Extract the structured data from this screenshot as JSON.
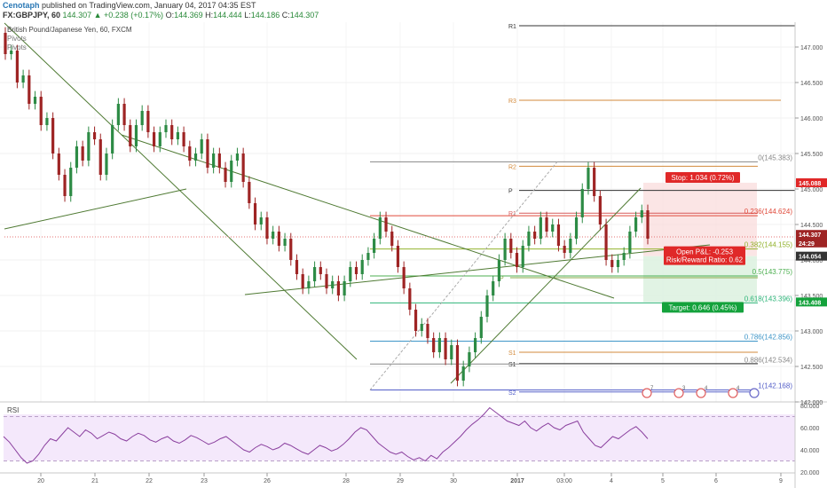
{
  "header": {
    "author": "Cenotaph",
    "published": "published on TradingView.com, January 04, 2017 04:35 EST",
    "symbol": "FX:GBPJPY, 60",
    "change": "144.307 ▲ +0.238 (+0.17%)",
    "ohlc": [
      {
        "k": "O:",
        "v": "144.369"
      },
      {
        "k": "H:",
        "v": "144.444"
      },
      {
        "k": "L:",
        "v": "144.186"
      },
      {
        "k": "C:",
        "v": "144.307"
      }
    ]
  },
  "legend": {
    "instrument": "British Pound/Japanese Yen, 60, FXCM",
    "items": [
      "Pivots",
      "Pivots"
    ]
  },
  "chart_data": [
    {
      "type": "candlestick",
      "title": "British Pound/Japanese Yen, 60, FXCM",
      "ylim": [
        142.0,
        147.35
      ],
      "y_ticks": [
        "147.000",
        "146.500",
        "146.000",
        "145.500",
        "145.000",
        "144.500",
        "144.000",
        "143.500",
        "143.000",
        "142.500",
        "142.000"
      ],
      "x_ticks": [
        "20",
        "21",
        "22",
        "23",
        "26",
        "28",
        "29",
        "30",
        "2017",
        "03:00",
        "4",
        "5",
        "6",
        "9"
      ],
      "candles": [
        [
          147.2,
          146.9
        ],
        [
          146.9,
          146.95
        ],
        [
          146.95,
          146.5
        ],
        [
          146.5,
          146.6
        ],
        [
          146.6,
          146.2
        ],
        [
          146.2,
          146.3
        ],
        [
          146.3,
          145.9
        ],
        [
          145.9,
          146.0
        ],
        [
          146.0,
          145.5
        ],
        [
          145.5,
          145.2
        ],
        [
          145.2,
          144.9
        ],
        [
          144.9,
          145.3
        ],
        [
          145.3,
          145.6
        ],
        [
          145.6,
          145.4
        ],
        [
          145.4,
          145.8
        ],
        [
          145.8,
          145.7
        ],
        [
          145.7,
          145.2
        ],
        [
          145.2,
          145.5
        ],
        [
          145.5,
          145.9
        ],
        [
          145.9,
          146.2
        ],
        [
          146.2,
          145.9
        ],
        [
          145.9,
          145.6
        ],
        [
          145.6,
          145.9
        ],
        [
          145.9,
          146.1
        ],
        [
          146.1,
          145.8
        ],
        [
          145.8,
          145.6
        ],
        [
          145.6,
          145.8
        ],
        [
          145.8,
          145.9
        ],
        [
          145.9,
          145.7
        ],
        [
          145.7,
          145.8
        ],
        [
          145.8,
          145.6
        ],
        [
          145.6,
          145.4
        ],
        [
          145.4,
          145.5
        ],
        [
          145.5,
          145.7
        ],
        [
          145.7,
          145.3
        ],
        [
          145.3,
          145.5
        ],
        [
          145.5,
          145.3
        ],
        [
          145.3,
          145.1
        ],
        [
          145.1,
          145.4
        ],
        [
          145.4,
          145.5
        ],
        [
          145.5,
          145.1
        ],
        [
          145.1,
          144.8
        ],
        [
          144.8,
          144.5
        ],
        [
          144.5,
          144.6
        ],
        [
          144.6,
          144.3
        ],
        [
          144.3,
          144.4
        ],
        [
          144.4,
          144.2
        ],
        [
          144.2,
          144.3
        ],
        [
          144.3,
          144.0
        ],
        [
          144.0,
          143.8
        ],
        [
          143.8,
          143.6
        ],
        [
          143.6,
          143.7
        ],
        [
          143.7,
          143.9
        ],
        [
          143.9,
          143.8
        ],
        [
          143.8,
          143.6
        ],
        [
          143.6,
          143.7
        ],
        [
          143.7,
          143.5
        ],
        [
          143.5,
          143.7
        ],
        [
          143.7,
          143.9
        ],
        [
          143.9,
          143.8
        ],
        [
          143.8,
          144.0
        ],
        [
          144.0,
          144.1
        ],
        [
          144.1,
          144.3
        ],
        [
          144.3,
          144.6
        ],
        [
          144.6,
          144.4
        ],
        [
          144.4,
          144.2
        ],
        [
          144.2,
          143.9
        ],
        [
          143.9,
          143.6
        ],
        [
          143.6,
          143.3
        ],
        [
          143.3,
          143.0
        ],
        [
          143.0,
          143.1
        ],
        [
          143.1,
          142.9
        ],
        [
          142.9,
          142.7
        ],
        [
          142.7,
          142.9
        ],
        [
          142.9,
          142.6
        ],
        [
          142.6,
          142.8
        ],
        [
          142.8,
          142.3
        ],
        [
          142.3,
          142.5
        ],
        [
          142.5,
          142.7
        ],
        [
          142.7,
          142.9
        ],
        [
          142.9,
          143.2
        ],
        [
          143.2,
          143.5
        ],
        [
          143.5,
          143.7
        ],
        [
          143.7,
          144.0
        ],
        [
          144.0,
          144.3
        ],
        [
          144.3,
          144.1
        ],
        [
          144.1,
          143.9
        ],
        [
          143.9,
          144.2
        ],
        [
          144.2,
          144.4
        ],
        [
          144.4,
          144.3
        ],
        [
          144.3,
          144.6
        ],
        [
          144.6,
          144.4
        ],
        [
          144.4,
          144.5
        ],
        [
          144.5,
          144.2
        ],
        [
          144.2,
          144.1
        ],
        [
          144.1,
          144.3
        ],
        [
          144.3,
          144.6
        ],
        [
          144.6,
          145.0
        ],
        [
          145.0,
          145.3
        ],
        [
          145.3,
          144.9
        ],
        [
          144.9,
          144.5
        ],
        [
          144.5,
          144.0
        ],
        [
          144.0,
          143.9
        ],
        [
          143.9,
          144.0
        ],
        [
          144.0,
          144.1
        ],
        [
          144.1,
          144.4
        ],
        [
          144.4,
          144.6
        ],
        [
          144.6,
          144.7
        ],
        [
          144.7,
          144.3
        ]
      ]
    },
    {
      "type": "line",
      "title": "RSI",
      "ylim": [
        20,
        80
      ],
      "y_ticks": [
        "80.000",
        "60.000",
        "40.000",
        "20.000"
      ],
      "values": [
        52,
        47,
        40,
        33,
        28,
        30,
        36,
        44,
        50,
        48,
        54,
        60,
        56,
        52,
        58,
        55,
        50,
        53,
        56,
        54,
        50,
        48,
        52,
        55,
        53,
        49,
        47,
        50,
        52,
        48,
        46,
        49,
        53,
        51,
        48,
        45,
        47,
        50,
        52,
        48,
        44,
        40,
        38,
        42,
        45,
        43,
        40,
        42,
        46,
        44,
        41,
        38,
        36,
        40,
        44,
        42,
        39,
        41,
        45,
        50,
        56,
        60,
        58,
        52,
        46,
        42,
        38,
        36,
        38,
        34,
        31,
        33,
        30,
        35,
        32,
        38,
        42,
        47,
        52,
        58,
        63,
        67,
        72,
        78,
        74,
        70,
        66,
        64,
        62,
        66,
        60,
        57,
        61,
        64,
        60,
        58,
        62,
        64,
        66,
        56,
        50,
        44,
        42,
        47,
        52,
        50,
        54,
        58,
        61,
        56,
        50
      ]
    }
  ],
  "price_labels": {
    "current": "144.307",
    "countdown": "24:29",
    "stop_level": "145.088",
    "entry_level": "144.054",
    "target_level": "143.408"
  },
  "pivots": [
    {
      "name": "R1",
      "price": 147.3
    },
    {
      "name": "R3",
      "price": 146.25
    },
    {
      "name": "R2",
      "price": 145.32
    },
    {
      "name": "P",
      "price": 144.98
    },
    {
      "name": "R1",
      "price": 144.66
    },
    {
      "name": "P",
      "price": 143.75
    },
    {
      "name": "S1",
      "price": 142.7
    },
    {
      "name": "S1",
      "price": 142.54
    },
    {
      "name": "S2",
      "price": 142.14
    }
  ],
  "fib_levels": [
    {
      "label": "0(145.383)",
      "price": 145.383,
      "color": "#888888"
    },
    {
      "label": "0.236(144.624)",
      "price": 144.624,
      "color": "#e04a3b"
    },
    {
      "label": "0.382(144.155)",
      "price": 144.155,
      "color": "#93b32e"
    },
    {
      "label": "0.5(143.775)",
      "price": 143.775,
      "color": "#4caf50"
    },
    {
      "label": "0.618(143.396)",
      "price": 143.396,
      "color": "#2fb57a"
    },
    {
      "label": "0.786(142.856)",
      "price": 142.856,
      "color": "#3f96c8"
    },
    {
      "label": "0.886(142.534)",
      "price": 142.534,
      "color": "#888888"
    },
    {
      "label": "1(142.168)",
      "price": 142.168,
      "color": "#5560c8"
    }
  ],
  "position": {
    "stop": "Stop: 1.034 (0.72%)",
    "pnl": "Open P&L: -0.253",
    "ratio": "Risk/Reward Ratio: 0.62",
    "target": "Target: 0.646 (0.45%)"
  },
  "events": [
    "7",
    "3",
    "4",
    "4"
  ],
  "colors": {
    "up": "#2d8b45",
    "down": "#9e2424",
    "trend": "#4f7a33",
    "stop": "#e02828",
    "target": "#14a23c",
    "rsi": "#8a3f9e",
    "rsi_fill": "#f4e8fb"
  }
}
